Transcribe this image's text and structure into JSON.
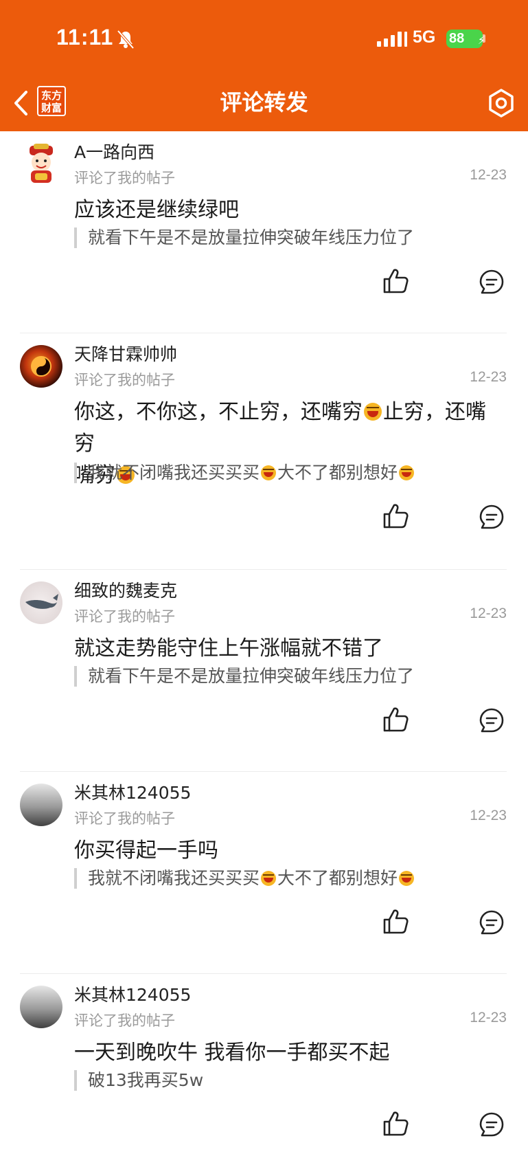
{
  "status_bar": {
    "time": "11:11",
    "network": "5G",
    "battery": "88"
  },
  "header": {
    "logo_line1": "东方",
    "logo_line2": "财富",
    "title": "评论转发"
  },
  "colors": {
    "brand": "#ec5b0c",
    "battery": "#4ad44a"
  },
  "items": [
    {
      "username": "A一路向西",
      "action": "评论了我的帖子",
      "date": "12-23",
      "comment_parts": [
        "应该还是继续绿吧"
      ],
      "quote_parts": [
        "就看下午是不是放量拉伸突破年线压力位了"
      ]
    },
    {
      "username": "天降甘霖帅帅",
      "action": "评论了我的帖子",
      "date": "12-23",
      "comment_parts": [
        "你这，不你这，不止穷，还嘴穷",
        "止穷，还嘴穷",
        ""
      ],
      "quote_parts": [
        "我就不闭嘴我还买买买",
        "大不了都别想好",
        ""
      ]
    },
    {
      "username": "细致的魏麦克",
      "action": "评论了我的帖子",
      "date": "12-23",
      "comment_parts": [
        "就这走势能守住上午涨幅就不错了"
      ],
      "quote_parts": [
        "就看下午是不是放量拉伸突破年线压力位了"
      ]
    },
    {
      "username": "米其林124055",
      "action": "评论了我的帖子",
      "date": "12-23",
      "comment_parts": [
        "你买得起一手吗"
      ],
      "quote_parts": [
        "我就不闭嘴我还买买买",
        "大不了都别想好",
        ""
      ]
    },
    {
      "username": "米其林124055",
      "action": "评论了我的帖子",
      "date": "12-23",
      "comment_parts": [
        "一天到晚吹牛 我看你一手都买不起"
      ],
      "quote_parts": [
        "破13我再买5w"
      ]
    }
  ]
}
